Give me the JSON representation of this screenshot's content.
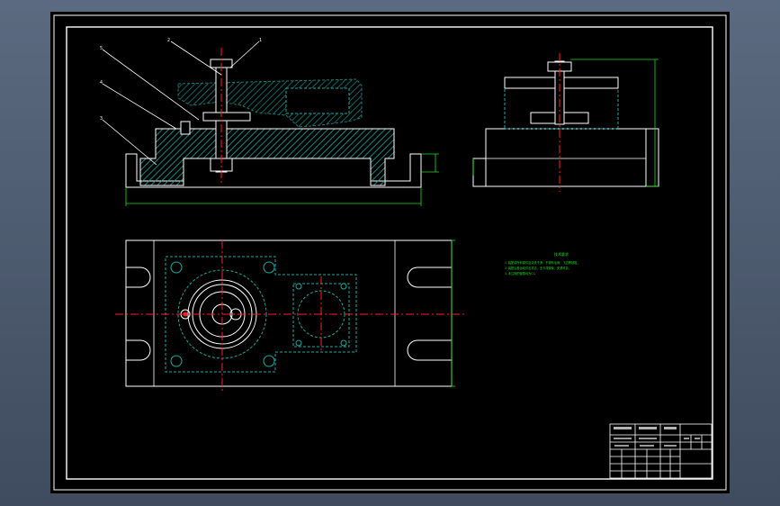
{
  "colors": {
    "background": "#000000",
    "frame": "#ffffff",
    "outline": "#ffffff",
    "hatch": "#1ea7a0",
    "hidden": "#1ea7a0",
    "center": "#ff2020",
    "dimension": "#22dd22",
    "note": "#22dd22",
    "titleblock": "#ffffff"
  },
  "leaders": [
    {
      "id": "1",
      "label": "1"
    },
    {
      "id": "2",
      "label": "2"
    },
    {
      "id": "3",
      "label": "3"
    },
    {
      "id": "4",
      "label": "4"
    },
    {
      "id": "5",
      "label": "5"
    }
  ],
  "notes": {
    "title": "技术要求",
    "lines": [
      "1.装配前所有零件应清洗干净，不得有毛刺、飞边等缺陷。",
      "2.装配后各运动件应灵活，无卡滞现象，夹紧可靠。",
      "3.未注明的倒角均为C1。"
    ]
  }
}
